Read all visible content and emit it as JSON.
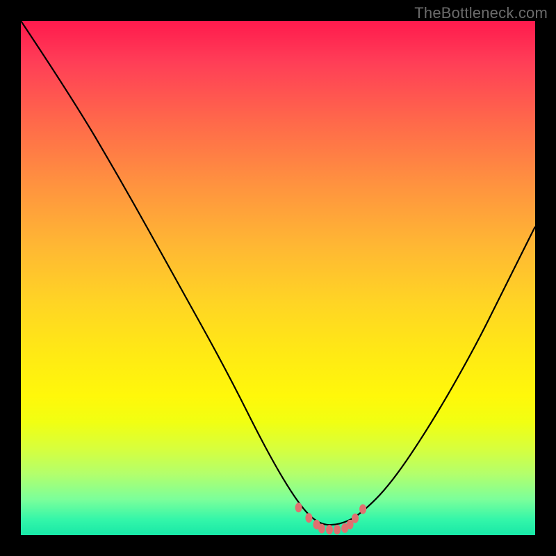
{
  "attribution": "TheBottleneck.com",
  "chart_data": {
    "type": "line",
    "title": "",
    "xlabel": "",
    "ylabel": "",
    "xlim": [
      0,
      1
    ],
    "ylim": [
      0,
      1
    ],
    "series": [
      {
        "name": "curve",
        "x": [
          0.0,
          0.1,
          0.2,
          0.3,
          0.4,
          0.48,
          0.54,
          0.58,
          0.62,
          0.66,
          0.72,
          0.8,
          0.88,
          0.94,
          1.0
        ],
        "y": [
          1.0,
          0.85,
          0.68,
          0.5,
          0.32,
          0.16,
          0.06,
          0.02,
          0.02,
          0.04,
          0.1,
          0.22,
          0.36,
          0.48,
          0.6
        ]
      }
    ],
    "markers": {
      "color": "#e07070",
      "points_x": [
        0.54,
        0.56,
        0.575,
        0.585,
        0.6,
        0.615,
        0.63,
        0.64,
        0.65,
        0.665
      ],
      "points_y": [
        0.055,
        0.035,
        0.022,
        0.014,
        0.012,
        0.012,
        0.015,
        0.022,
        0.034,
        0.052
      ]
    },
    "background_gradient": [
      "#ff1a4d",
      "#ff933f",
      "#ffea14",
      "#b4ff6b",
      "#18e8a8"
    ]
  }
}
